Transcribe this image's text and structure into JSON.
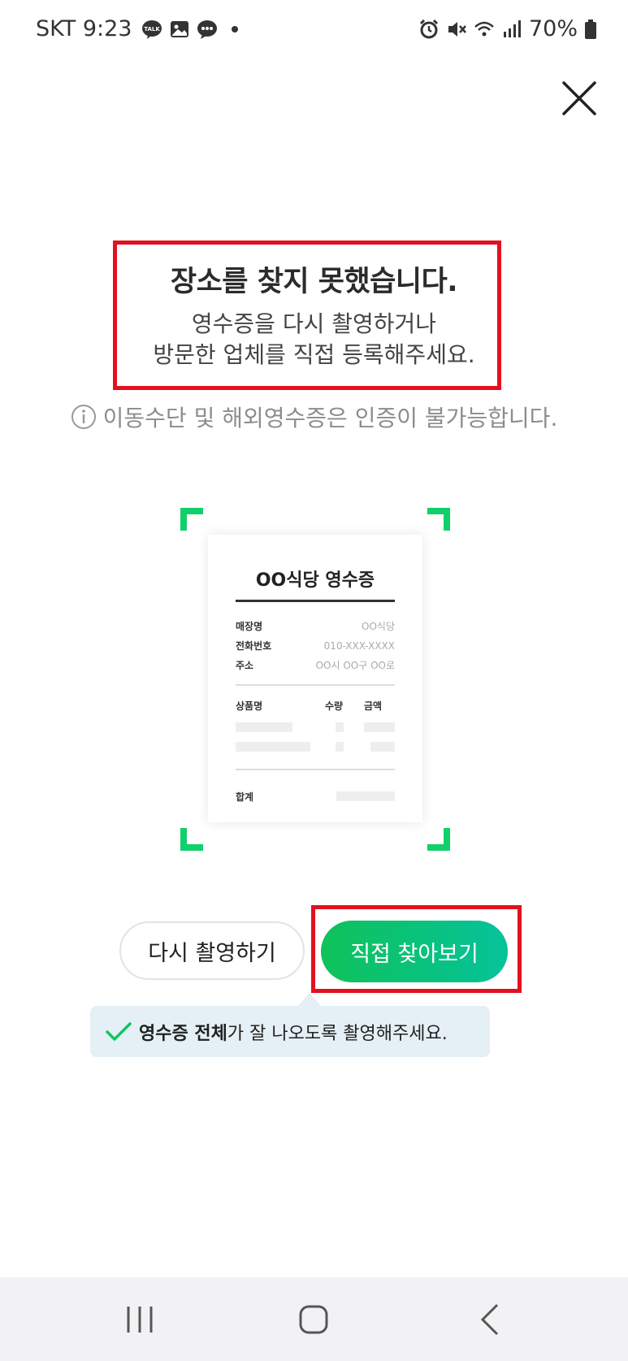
{
  "status_bar": {
    "carrier_time": "SKT 9:23",
    "talk_badge": "TALK",
    "battery": "70%",
    "notification_icons": [
      "kakaotalk-icon",
      "gallery-icon",
      "chat-bubble-icon",
      "dot-icon"
    ],
    "system_icons": [
      "alarm-icon",
      "mute-icon",
      "wifi-icon",
      "signal-icon",
      "battery-icon"
    ]
  },
  "dialog": {
    "title": "장소를 찾지 못했습니다.",
    "subtitle_line1": "영수증을 다시 촬영하거나",
    "subtitle_line2": "방문한 업체를 직접 등록해주세요.",
    "notice": "이동수단 및 해외영수증은 인증이 불가능합니다."
  },
  "receipt": {
    "title": "OO식당 영수증",
    "fields": [
      {
        "label": "매장명",
        "value": "OO식당"
      },
      {
        "label": "전화번호",
        "value": "010-XXX-XXXX"
      },
      {
        "label": "주소",
        "value": "OO시 OO구 OO로"
      }
    ],
    "columns": [
      "상품명",
      "수량",
      "금액"
    ],
    "total_label": "합계"
  },
  "buttons": {
    "retake": "다시 촬영하기",
    "find_directly": "직접 찾아보기"
  },
  "tooltip": {
    "bold_text": "영수증 전체",
    "rest_text": "가 잘 나오도록 촬영해주세요."
  },
  "colors": {
    "accent_green": "#0fc25a",
    "highlight_red": "#e3101f",
    "tooltip_bg": "#e4f0f5"
  },
  "nav_bar": {
    "buttons": [
      "recents-icon",
      "home-icon",
      "back-icon"
    ]
  }
}
